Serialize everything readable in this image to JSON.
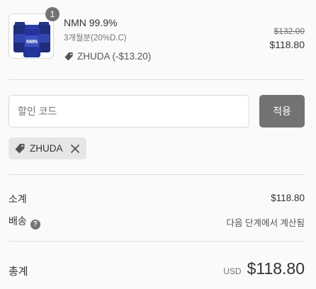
{
  "product": {
    "name": "NMN 99.9%",
    "variant": "3개월분(20%D.C)",
    "quantity": "1",
    "discount_line": "ZHUDA (-$13.20)",
    "compare_price": "$132.00",
    "price": "$118.80",
    "image_label": "NMN"
  },
  "discount_form": {
    "placeholder": "할인 코드",
    "apply_label": "적용"
  },
  "applied_tag": {
    "code": "ZHUDA"
  },
  "summary": {
    "subtotal_label": "소계",
    "subtotal_value": "$118.80",
    "shipping_label": "배송",
    "shipping_value": "다음 단계에서 계산됨",
    "help_icon": "?",
    "total_label": "총계",
    "currency": "USD",
    "total_value": "$118.80"
  },
  "colors": {
    "button_bg": "#737373",
    "bottle": "#1f2d7a"
  },
  "icons": [
    "tag-icon",
    "close-icon",
    "question-icon"
  ]
}
